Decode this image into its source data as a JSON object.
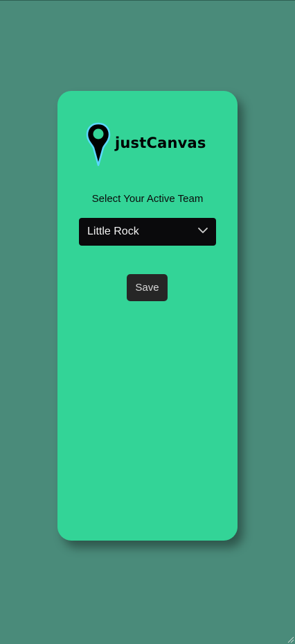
{
  "brand": {
    "name": "justCanvas",
    "logo_icon": "map-pin-icon"
  },
  "form": {
    "prompt": "Select Your Active Team",
    "team_select": {
      "selected": "Little Rock",
      "icon": "chevron-down-icon"
    },
    "save_label": "Save"
  },
  "colors": {
    "background": "#4a8b7a",
    "card": "#33d497",
    "select_bg": "#0a0a0c",
    "button_bg": "#262626",
    "pin_outline": "#5ad8ff"
  }
}
